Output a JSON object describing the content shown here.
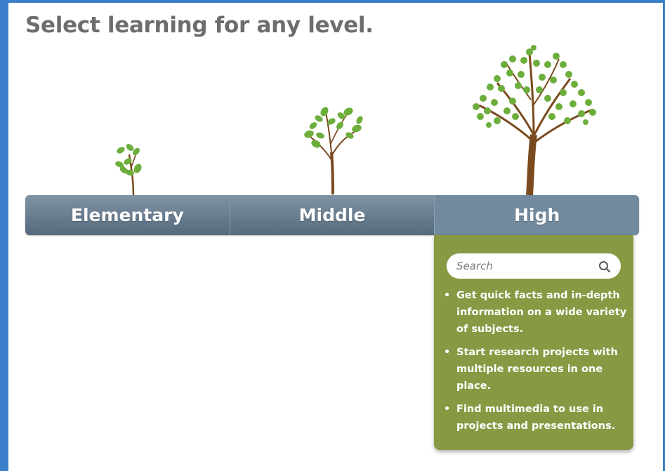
{
  "heading": "Select learning for any level.",
  "levels": {
    "elementary": "Elementary",
    "middle": "Middle",
    "high": "High"
  },
  "active_level": "High",
  "search": {
    "placeholder": "Search",
    "icon": "search-icon"
  },
  "high_features": [
    "Get quick facts and in-depth information on a wide variety of subjects.",
    "Start research projects with multiple resources in one place.",
    "Find multimedia to use in projects and presentations."
  ],
  "colors": {
    "frame": "#3b7ec9",
    "heading": "#6d6d6d",
    "tab_bar": "#5f7486",
    "dropdown": "#879a43",
    "trunk": "#7a4a1e",
    "leaf": "#6cae3b"
  }
}
